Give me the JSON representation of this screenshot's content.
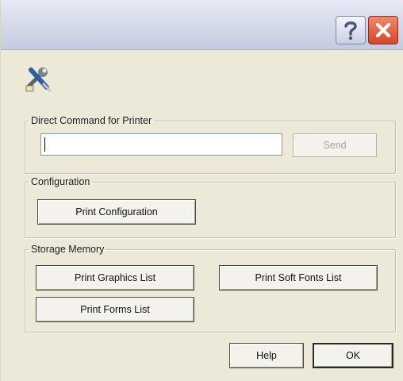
{
  "window": {
    "title": "",
    "help_icon": "question-mark",
    "close_icon": "x-close"
  },
  "app_icon": "printer-tools-icon",
  "direct_command": {
    "legend": "Direct Command for Printer",
    "input_value": "",
    "send_label": "Send",
    "send_enabled": false
  },
  "configuration": {
    "legend": "Configuration",
    "print_config_label": "Print Configuration"
  },
  "storage": {
    "legend": "Storage Memory",
    "print_graphics_label": "Print Graphics List",
    "print_soft_fonts_label": "Print Soft Fonts List",
    "print_forms_label": "Print Forms List"
  },
  "footer": {
    "help_label": "Help",
    "ok_label": "OK"
  },
  "colors": {
    "dialog_bg": "#ece9d8",
    "close_red": "#d8452a",
    "titlebar": "#d6dbeb"
  }
}
